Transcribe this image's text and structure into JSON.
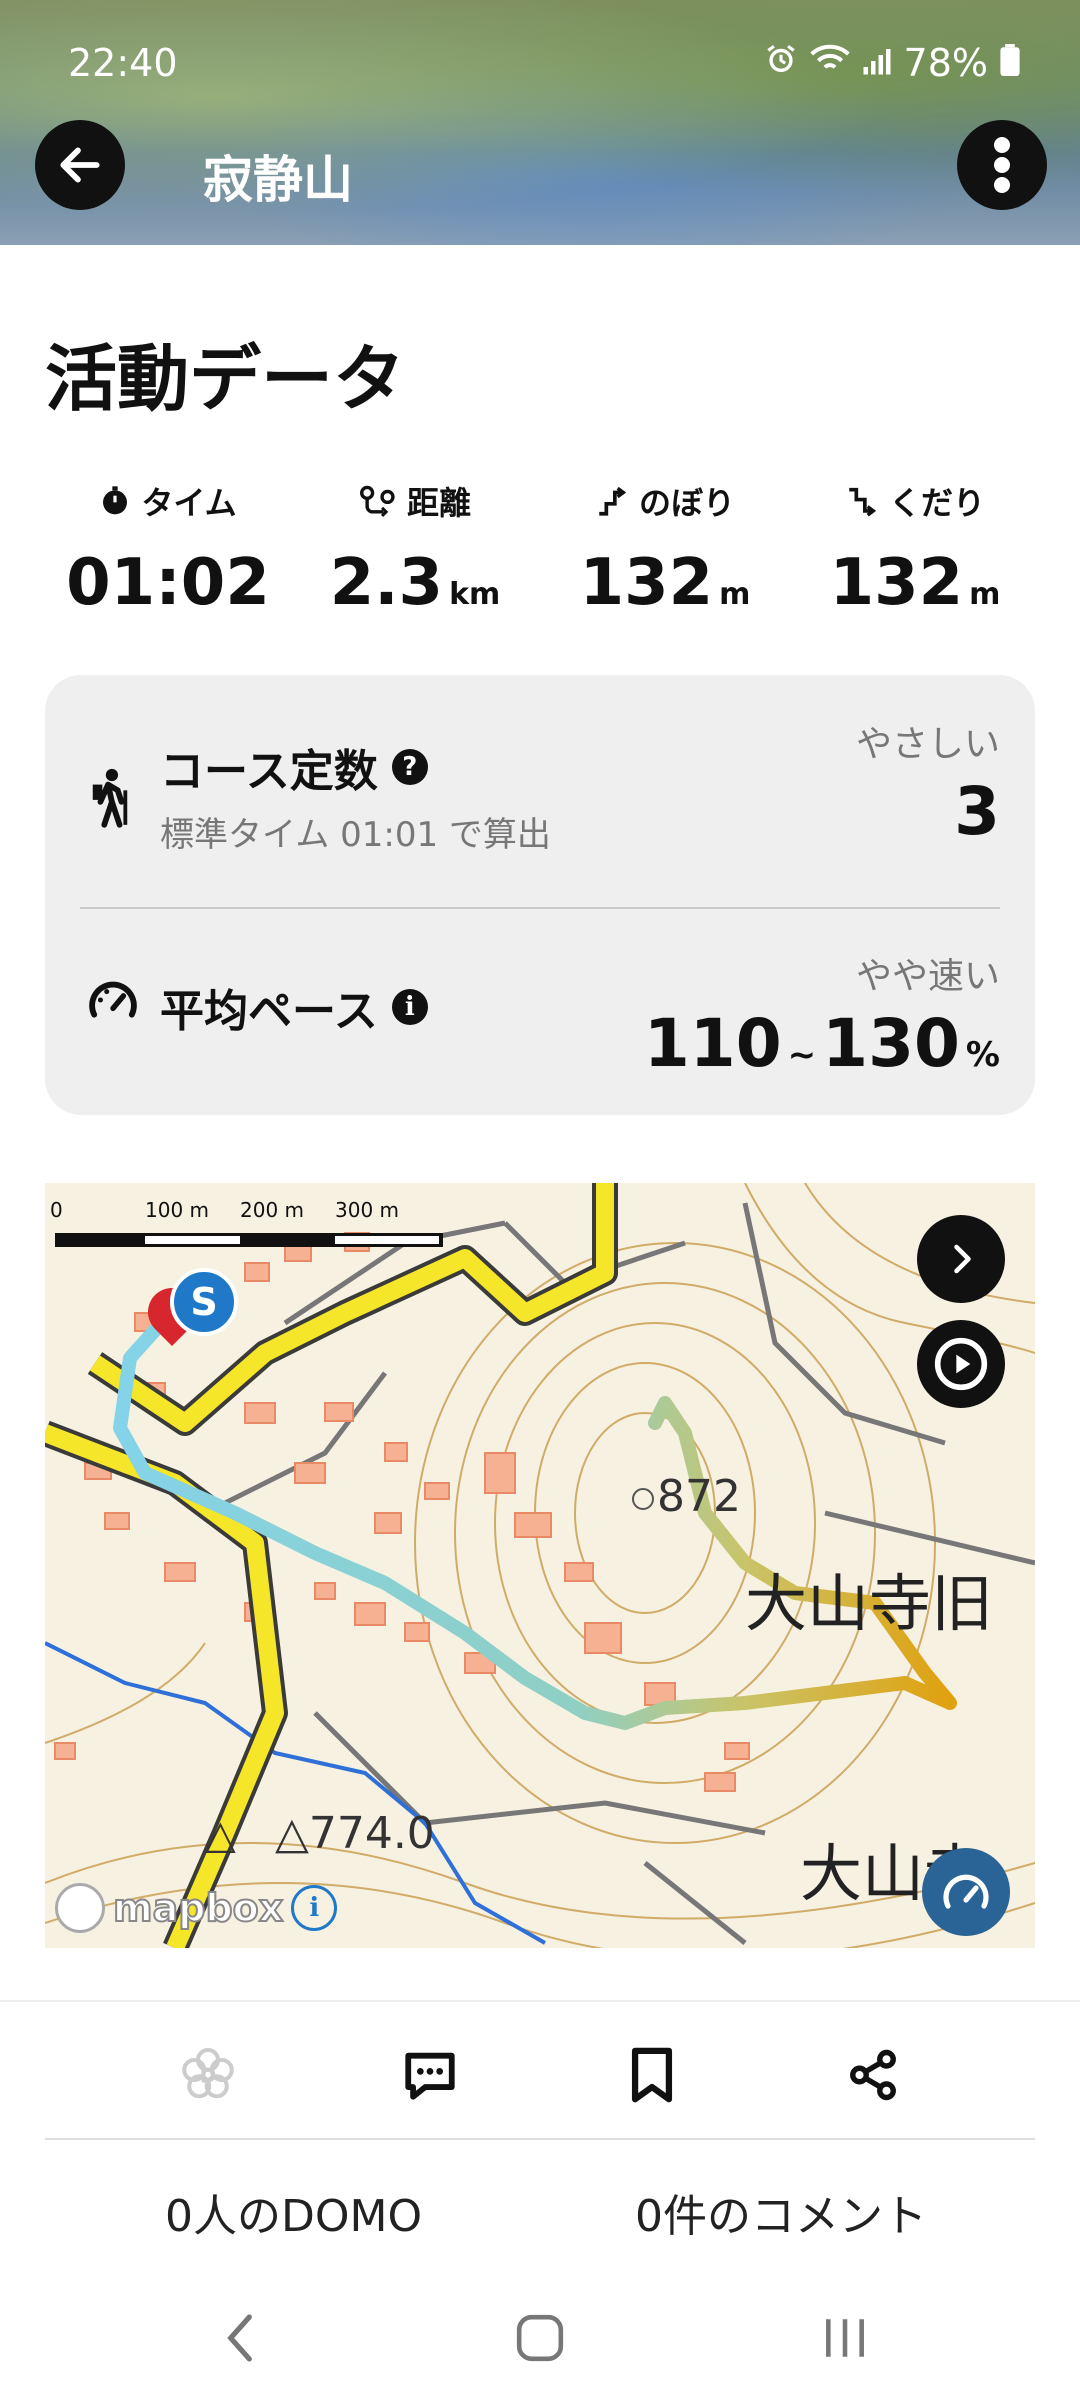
{
  "status_bar": {
    "time": "22:40",
    "battery": "78%"
  },
  "header": {
    "title": "寂静山"
  },
  "section": {
    "title": "活動データ"
  },
  "stats": [
    {
      "label": "タイム",
      "value": "01:02",
      "unit": "",
      "icon": "stopwatch-icon"
    },
    {
      "label": "距離",
      "value": "2.3",
      "unit": "km",
      "icon": "distance-icon"
    },
    {
      "label": "のぼり",
      "value": "132",
      "unit": "m",
      "icon": "ascent-icon"
    },
    {
      "label": "くだり",
      "value": "132",
      "unit": "m",
      "icon": "descent-icon"
    }
  ],
  "course": {
    "title": "コース定数",
    "subtitle": "標準タイム 01:01 で算出",
    "difficulty": "やさしい",
    "value": "3"
  },
  "pace": {
    "title": "平均ペース",
    "speed_label": "やや速い",
    "min": "110",
    "sep": "~",
    "max": "130",
    "unit": "%"
  },
  "map": {
    "scale_labels": [
      "0",
      "100 m",
      "200 m",
      "300 m"
    ],
    "start_marker": "S",
    "summit_label": "872",
    "label_temple": "大山寺旧",
    "label_point": "△774.0",
    "label_bottom": "大山寺",
    "attribution": "mapbox",
    "colors": {
      "route_start": "#7fd3e6",
      "route_end": "#e0a10e",
      "road": "#f3e31f"
    }
  },
  "actions": {
    "domo_count": "0人のDOMO",
    "comment_count": "0件のコメント"
  }
}
